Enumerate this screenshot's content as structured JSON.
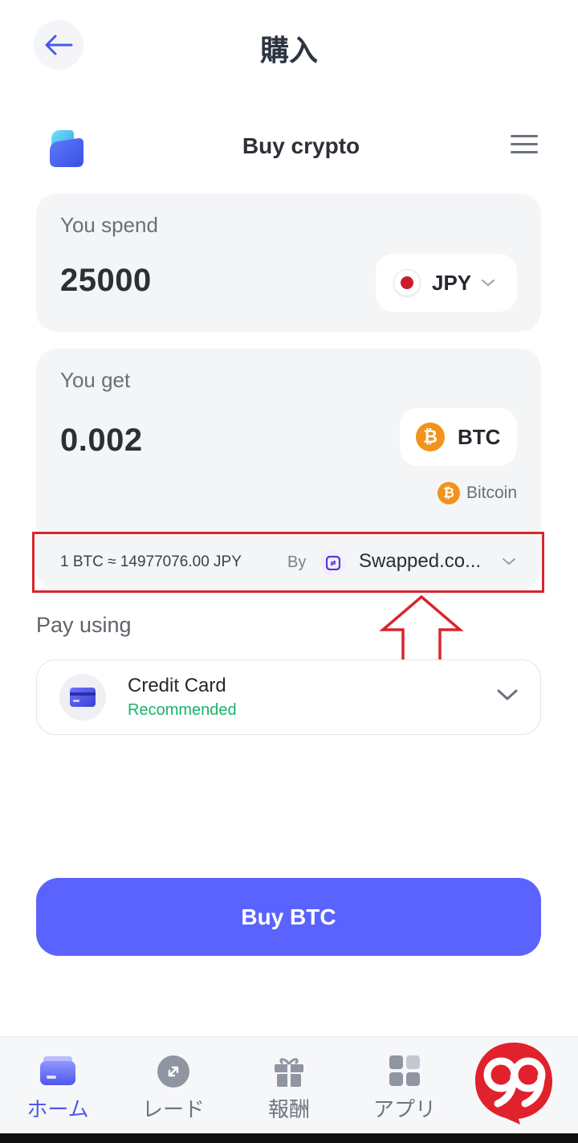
{
  "topbar": {
    "title": "購入"
  },
  "widget": {
    "title": "Buy crypto"
  },
  "spend": {
    "label": "You spend",
    "value": "25000",
    "currency": "JPY"
  },
  "get": {
    "label": "You get",
    "value": "0.002",
    "currency": "BTC",
    "currency_name": "Bitcoin"
  },
  "rate": {
    "text": "1 BTC ≈ 14977076.00 JPY",
    "by_label": "By",
    "provider": "Swapped.co..."
  },
  "pay": {
    "label": "Pay using",
    "method": "Credit Card",
    "recommended": "Recommended"
  },
  "buy_button": {
    "label": "Buy BTC"
  },
  "nav": {
    "items": [
      {
        "label": "ホーム",
        "icon": "wallet-icon",
        "active": true
      },
      {
        "label": "レード",
        "icon": "trade-icon",
        "active": false
      },
      {
        "label": "報酬",
        "icon": "gift-icon",
        "active": false
      },
      {
        "label": "アプリ",
        "icon": "apps-grid-icon",
        "active": false
      }
    ]
  },
  "watermark": {
    "text": "99"
  },
  "colors": {
    "accent": "#5b63fe",
    "recommended": "#18b46a",
    "annotation": "#d7262d",
    "bitcoin": "#f2931a"
  }
}
